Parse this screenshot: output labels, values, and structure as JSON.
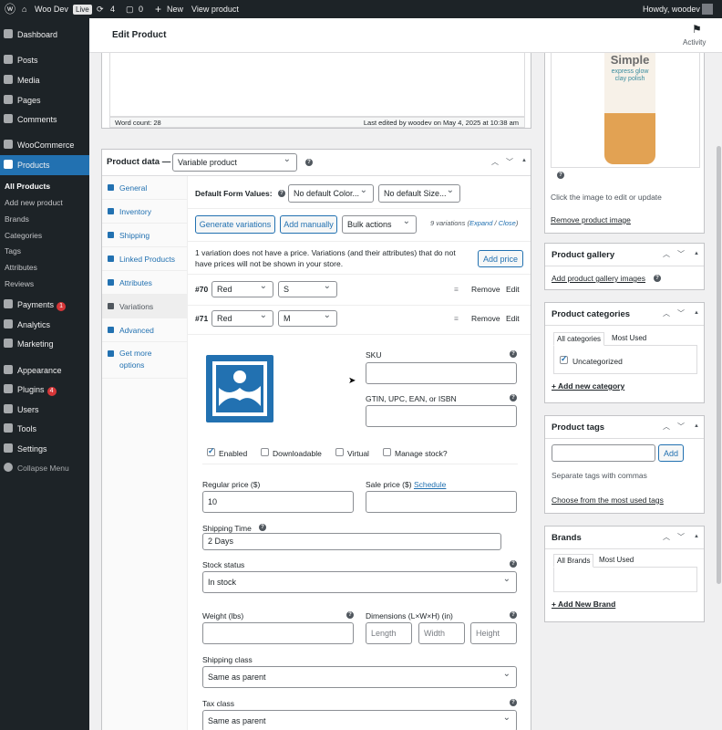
{
  "adminbar": {
    "site": "Woo Dev",
    "live": "Live",
    "updates": "4",
    "comments": "0",
    "new": "New",
    "view": "View product",
    "howdy": "Howdy, woodev"
  },
  "menu": {
    "dashboard": "Dashboard",
    "posts": "Posts",
    "media": "Media",
    "pages": "Pages",
    "comments": "Comments",
    "woocommerce": "WooCommerce",
    "products": "Products",
    "sub": [
      "All Products",
      "Add new product",
      "Brands",
      "Categories",
      "Tags",
      "Attributes",
      "Reviews"
    ],
    "payments": "Payments",
    "payments_badge": "1",
    "analytics": "Analytics",
    "marketing": "Marketing",
    "appearance": "Appearance",
    "plugins": "Plugins",
    "plugins_badge": "4",
    "users": "Users",
    "tools": "Tools",
    "settings": "Settings",
    "collapse": "Collapse Menu"
  },
  "header": {
    "title": "Edit Product",
    "activity": "Activity"
  },
  "editor": {
    "word_count": "Word count: 28",
    "last_edited": "Last edited by woodev on May 4, 2025 at 10:38 am"
  },
  "product_data": {
    "title": "Product data —",
    "type": "Variable product",
    "tabs": [
      "General",
      "Inventory",
      "Shipping",
      "Linked Products",
      "Attributes",
      "Variations",
      "Advanced",
      "Get more options"
    ],
    "default_label": "Default Form Values:",
    "default_color": "No default Color...",
    "default_size": "No default Size...",
    "generate": "Generate variations",
    "add_manually": "Add manually",
    "bulk": "Bulk actions",
    "count": "9 variations",
    "expand": "Expand",
    "sep": "/",
    "close": "Close",
    "notice": "1 variation does not have a price. Variations (and their attributes) that do not have prices will not be shown in your store.",
    "add_price": "Add price",
    "variations": [
      {
        "id": "#70",
        "color": "Red",
        "size": "S",
        "remove": "Remove",
        "edit": "Edit"
      },
      {
        "id": "#71",
        "color": "Red",
        "size": "M",
        "remove": "Remove",
        "edit": "Edit"
      }
    ],
    "form": {
      "sku": "SKU",
      "gtin": "GTIN, UPC, EAN, or ISBN",
      "enabled": "Enabled",
      "downloadable": "Downloadable",
      "virtual": "Virtual",
      "manage_stock": "Manage stock?",
      "regular_price": "Regular price ($)",
      "regular_value": "10",
      "sale_price": "Sale price ($)",
      "schedule": "Schedule",
      "shipping_time": "Shipping Time",
      "shipping_time_value": "2 Days",
      "stock_status": "Stock status",
      "stock_value": "In stock",
      "weight": "Weight (lbs)",
      "dimensions": "Dimensions (L×W×H) (in)",
      "length": "Length",
      "width": "Width",
      "height": "Height",
      "shipping_class": "Shipping class",
      "shipping_class_value": "Same as parent",
      "tax_class": "Tax class",
      "tax_class_value": "Same as parent"
    }
  },
  "product_image": {
    "brand": "Simple",
    "line1": "express glow",
    "line2": "clay polish",
    "edit_hint": "Click the image to edit or update",
    "remove": "Remove product image"
  },
  "gallery": {
    "title": "Product gallery",
    "add": "Add product gallery images"
  },
  "categories": {
    "title": "Product categories",
    "tab_all": "All categories",
    "tab_used": "Most Used",
    "item": "Uncategorized",
    "add": "+ Add new category"
  },
  "tags": {
    "title": "Product tags",
    "add_btn": "Add",
    "hint": "Separate tags with commas",
    "choose": "Choose from the most used tags"
  },
  "brands": {
    "title": "Brands",
    "tab_all": "All Brands",
    "tab_used": "Most Used",
    "add": "+ Add New Brand"
  }
}
